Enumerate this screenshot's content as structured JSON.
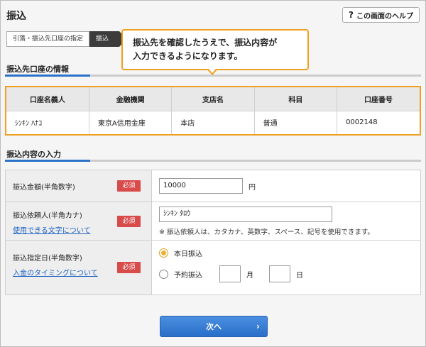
{
  "header": {
    "title": "振込",
    "help_label": "この画面のヘルプ",
    "help_icon": "question-icon"
  },
  "steps": [
    {
      "label": "引落・振込先口座の指定",
      "active": false
    },
    {
      "label": "振込",
      "active": true
    }
  ],
  "callout": {
    "line1": "振込先を確認したうえで、振込内容が",
    "line2": "入力できるようになります。"
  },
  "account_section": {
    "title": "振込先口座の情報",
    "columns": [
      "口座名義人",
      "金融機関",
      "支店名",
      "科目",
      "口座番号"
    ],
    "row": [
      "ｼﾝｷﾝ ﾊﾅｺ",
      "東京A信用金庫",
      "本店",
      "普通",
      "0002148"
    ]
  },
  "input_section": {
    "title": "振込内容の入力"
  },
  "form": {
    "required_badge": "必須",
    "amount": {
      "label": "振込金額(半角数字)",
      "value": "10000",
      "unit": "円"
    },
    "requester": {
      "label": "振込依頼人(半角カナ)",
      "link": "使用できる文字について",
      "value": "ｼﾝｷﾝ ﾀﾛｳ",
      "note": "※ 振込依頼人は、カタカナ、英数字、スペース、記号を使用できます。"
    },
    "date": {
      "label": "振込指定日(半角数字)",
      "link": "入金のタイミングについて",
      "option_today": "本日振込",
      "option_scheduled": "予約振込",
      "month_unit": "月",
      "day_unit": "日",
      "selected": "本日振込"
    }
  },
  "next_button": {
    "label": "次へ",
    "icon": "chevron-right-icon"
  },
  "colors": {
    "accent_orange": "#f0a020",
    "primary_blue": "#2a72c8",
    "required_red": "#d94a4a"
  }
}
